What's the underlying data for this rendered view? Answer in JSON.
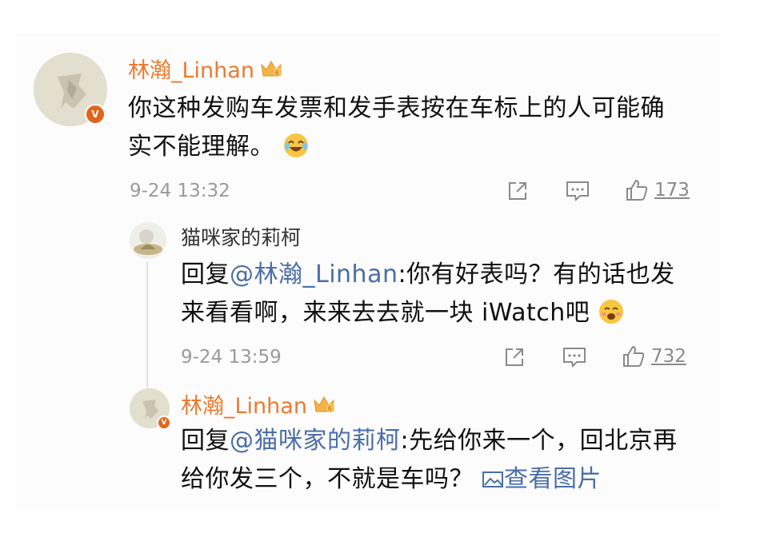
{
  "comment1": {
    "username": "林瀚_Linhan",
    "text": "你这种发购车发票和发手表按在车标上的人可能确实不能理解。",
    "emoji": "laughing-tears",
    "time": "9-24 13:32",
    "likes": "173"
  },
  "reply1": {
    "username": "猫咪家的莉柯",
    "prefix": "回复",
    "mention": "@林瀚_Linhan",
    "text": ":你有好表吗？有的话也发来看看啊，来来去去就一块 iWatch吧",
    "emoji": "blushing-smile",
    "time": "9-24 13:59",
    "likes": "732"
  },
  "reply2": {
    "username": "林瀚_Linhan",
    "prefix": "回复",
    "mention": "@猫咪家的莉柯",
    "text": ":先给你来一个，回北京再给你发三个，不就是车吗？",
    "image_link": "查看图片"
  },
  "colors": {
    "username": "#eb7a2e",
    "mention": "#4a6ea8",
    "verified_badge": "#e2641a",
    "meta": "#9a9a9a"
  },
  "badge_letter": "V"
}
